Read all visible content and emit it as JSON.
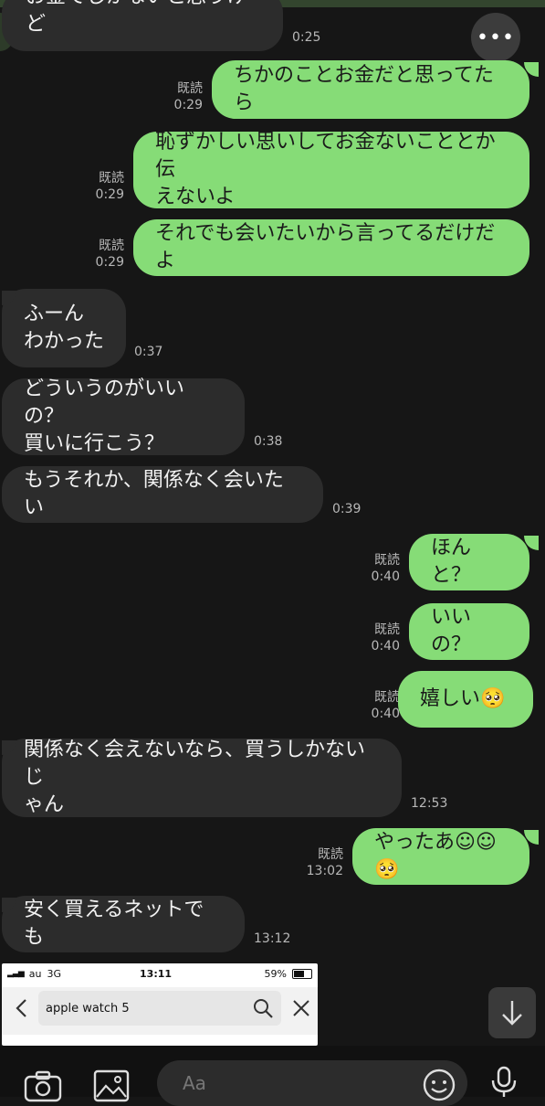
{
  "more_label": "•••",
  "messages": [
    {
      "side": "in",
      "text": "お金でしかないと思うけど",
      "time": "0:25",
      "read": ""
    },
    {
      "side": "out",
      "text": "ちかのことお金だと思ってたら",
      "time": "0:29",
      "read": "既読"
    },
    {
      "side": "out",
      "text": "恥ずかしい思いしてお金ないこととか伝\nえないよ",
      "time": "0:29",
      "read": "既読"
    },
    {
      "side": "out",
      "text": "それでも会いたいから言ってるだけだよ",
      "time": "0:29",
      "read": "既読"
    },
    {
      "side": "in",
      "text": "ふーん\nわかった",
      "time": "0:37",
      "read": ""
    },
    {
      "side": "in",
      "text": "どういうのがいいの？\n買いに行こう？",
      "time": "0:38",
      "read": ""
    },
    {
      "side": "in",
      "text": "もうそれか、関係なく会いたい",
      "time": "0:39",
      "read": ""
    },
    {
      "side": "out",
      "text": "ほんと？",
      "time": "0:40",
      "read": "既読"
    },
    {
      "side": "out",
      "text": "いいの？",
      "time": "0:40",
      "read": "既読"
    },
    {
      "side": "out",
      "text": "嬉しい🥺",
      "time": "0:40",
      "read": "既読"
    },
    {
      "side": "in",
      "text": "関係なく会えないなら、買うしかないじ\nゃん",
      "time": "12:53",
      "read": ""
    },
    {
      "side": "out",
      "text": "やったあ☺☺🥺",
      "time": "13:02",
      "read": "既読"
    },
    {
      "side": "in",
      "text": "安く買えるネットでも",
      "time": "13:12",
      "read": ""
    }
  ],
  "screenshot": {
    "carrier": "au",
    "network": "3G",
    "clock": "13:11",
    "battery": "59%",
    "search_text": "apple watch 5"
  },
  "composer": {
    "placeholder": "Aa"
  }
}
